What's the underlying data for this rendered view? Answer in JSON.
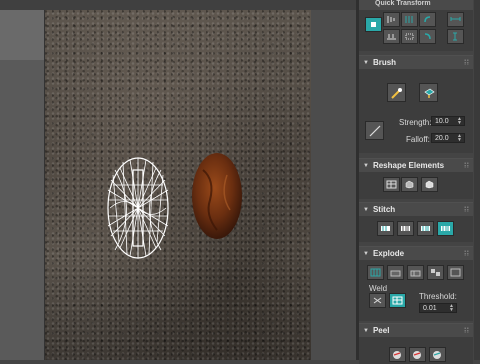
{
  "quick_transform": {
    "title": "Quick Transform"
  },
  "brush": {
    "title": "Brush",
    "strength_label": "Strength:",
    "strength_value": "10.0",
    "falloff_label": "Falloff:",
    "falloff_value": "20.0"
  },
  "reshape": {
    "title": "Reshape Elements"
  },
  "stitch": {
    "title": "Stitch"
  },
  "explode": {
    "title": "Explode",
    "weld_label": "Weld",
    "threshold_label": "Threshold:",
    "threshold_value": "0.01"
  },
  "peel": {
    "title": "Peel"
  },
  "colors": {
    "accent": "#2aa8a8",
    "panel_bg": "#3d3d3d",
    "header_bg": "#4a4a4a",
    "uv_mesh": "#ffffff"
  },
  "icons": [
    "uv-mesh-icon",
    "brush-paint-icon",
    "brush-relax-icon",
    "pin-icon",
    "stitch-icon",
    "explode-icon",
    "peel-icon"
  ]
}
